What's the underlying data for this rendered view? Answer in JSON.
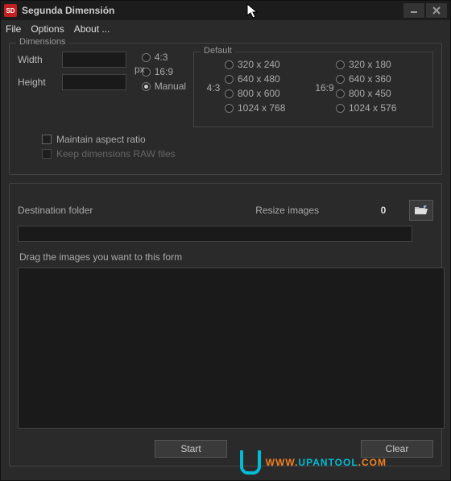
{
  "titlebar": {
    "icon_text": "SD",
    "title": "Segunda Dimensión"
  },
  "menu": {
    "file": "File",
    "options": "Options",
    "about": "About ..."
  },
  "dimensions": {
    "legend": "Dimensions",
    "width_label": "Width",
    "width_value": "",
    "height_label": "Height",
    "height_value": "",
    "px": "px",
    "ratio_43": "4:3",
    "ratio_169": "16:9",
    "ratio_manual": "Manual",
    "maintain": "Maintain aspect ratio",
    "keep_raw": "Keep dimensions RAW files"
  },
  "defaults": {
    "legend": "Default",
    "col1_label": "4:3",
    "col2_label": "16:9",
    "col1": [
      "320 x 240",
      "640 x 480",
      "800 x 600",
      "1024 x 768"
    ],
    "col2": [
      "320 x 180",
      "640 x 360",
      "800 x 450",
      "1024 x 576"
    ]
  },
  "dest": {
    "label": "Destination folder",
    "resize_label": "Resize images",
    "count": "0",
    "value": ""
  },
  "drag_label": "Drag the images you want to this form",
  "buttons": {
    "start": "Start",
    "clear": "Clear"
  },
  "watermark": {
    "prefix": "WWW.",
    "domain": "UPANTOOL",
    "suffix": ".COM"
  }
}
